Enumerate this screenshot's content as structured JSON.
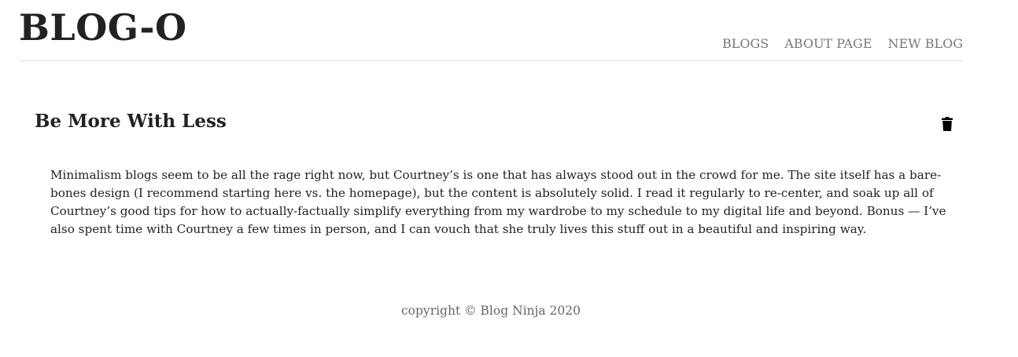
{
  "header": {
    "site_title": "BLOG-O",
    "nav": [
      {
        "label": "BLOGS"
      },
      {
        "label": "ABOUT PAGE"
      },
      {
        "label": "NEW BLOG"
      }
    ]
  },
  "post": {
    "title": "Be More With Less",
    "delete_icon": "trash-icon",
    "body": "Minimalism blogs seem to be all the rage right now, but Courtney’s is one that has always stood out in the crowd for me. The site itself has a bare-bones design (I recommend starting here vs. the homepage), but the content is absolutely solid. I read it regularly to re-center, and soak up all of Courtney’s good tips for how to actually-factually simplify everything from my wardrobe to my schedule to my digital life and beyond. Bonus — I’ve also spent time with Courtney a few times in person, and I can vouch that she truly lives this stuff out in a beautiful and inspiring way."
  },
  "footer": {
    "text": "copyright © Blog Ninja 2020"
  },
  "colors": {
    "text": "#222222",
    "nav": "#777777",
    "divider": "#dddddd",
    "footer": "#666666"
  }
}
